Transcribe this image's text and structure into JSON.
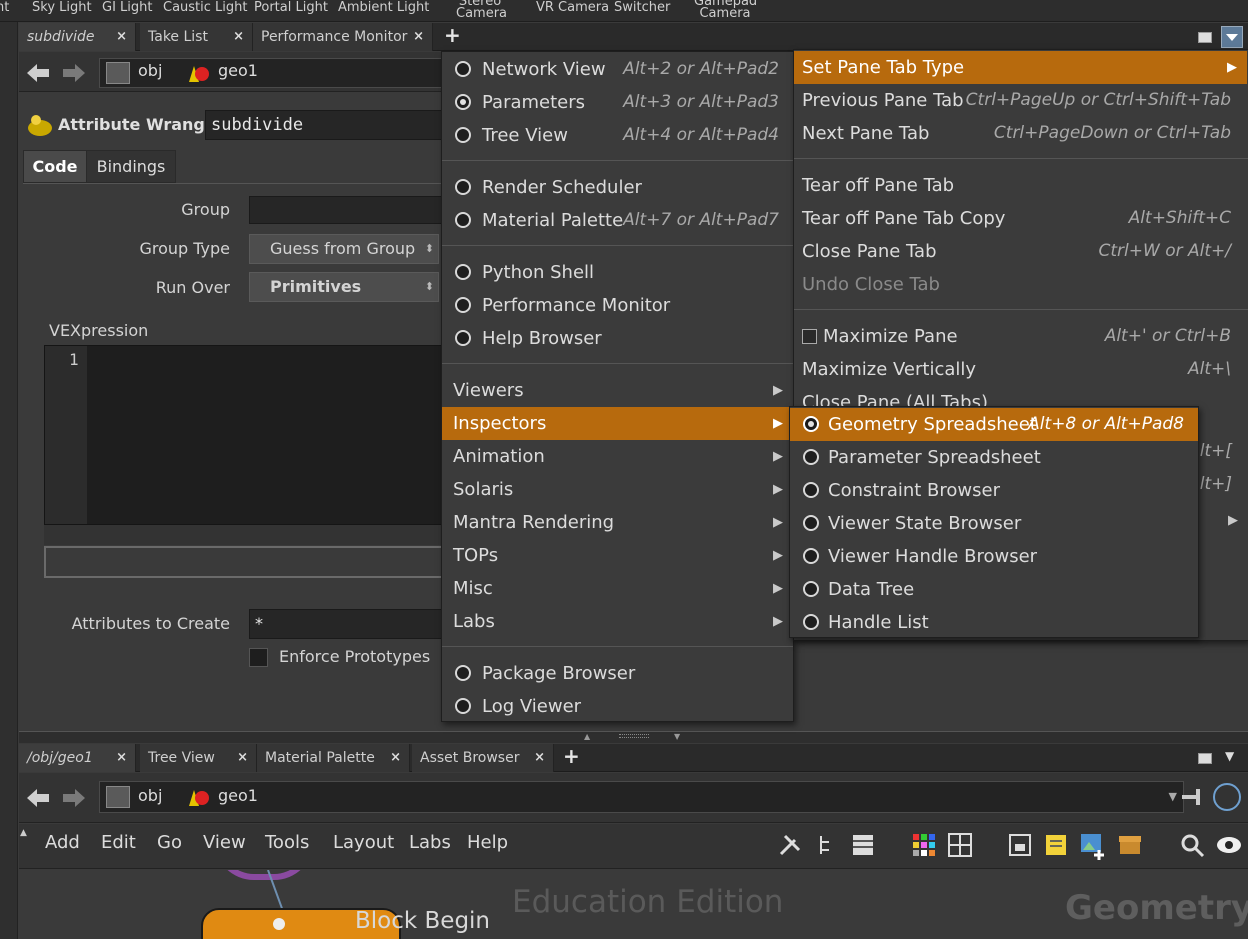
{
  "shelf": {
    "tools": [
      "Sky Light",
      "GI Light",
      "Caustic Light",
      "Portal Light",
      "Ambient Light",
      "Stereo Camera",
      "VR Camera",
      "Switcher",
      "Gamepad Camera"
    ],
    "partial_left": "nt"
  },
  "top_pane": {
    "tabs": [
      {
        "label": "subdivide",
        "close": "×"
      },
      {
        "label": "Take List",
        "close": "×"
      },
      {
        "label": "Performance Monitor",
        "close": "×"
      }
    ],
    "add_tab": "+",
    "path": {
      "network": "obj",
      "node": "geo1"
    },
    "node_type": "Attribute Wrangle",
    "node_name": "subdivide",
    "subtabs": [
      "Code",
      "Bindings"
    ],
    "params": {
      "group_label": "Group",
      "group_type_label": "Group Type",
      "group_type_value": "Guess from Group",
      "run_over_label": "Run Over",
      "run_over_value": "Primitives",
      "vex_label": "VEXpression",
      "line_number": "1",
      "attrs_label": "Attributes to Create",
      "attrs_value": "*",
      "enforce_label": "Enforce Prototypes"
    }
  },
  "pane_type_menu": {
    "items": [
      {
        "label": "Network View",
        "shortcut": "Alt+2 or Alt+Pad2",
        "radio": true,
        "on": false
      },
      {
        "label": "Parameters",
        "shortcut": "Alt+3 or Alt+Pad3",
        "radio": true,
        "on": true
      },
      {
        "label": "Tree View",
        "shortcut": "Alt+4 or Alt+Pad4",
        "radio": true,
        "on": false
      },
      {
        "label": "Render Scheduler",
        "shortcut": "",
        "radio": true,
        "on": false
      },
      {
        "label": "Material Palette",
        "shortcut": "Alt+7 or Alt+Pad7",
        "radio": true,
        "on": false
      },
      {
        "label": "Python Shell",
        "shortcut": "",
        "radio": true,
        "on": false
      },
      {
        "label": "Performance Monitor",
        "shortcut": "",
        "radio": true,
        "on": false
      },
      {
        "label": "Help Browser",
        "shortcut": "",
        "radio": true,
        "on": false
      },
      {
        "label": "Viewers",
        "submenu": true
      },
      {
        "label": "Inspectors",
        "submenu": true,
        "highlight": true
      },
      {
        "label": "Animation",
        "submenu": true
      },
      {
        "label": "Solaris",
        "submenu": true
      },
      {
        "label": "Mantra Rendering",
        "submenu": true
      },
      {
        "label": "TOPs",
        "submenu": true
      },
      {
        "label": "Misc",
        "submenu": true
      },
      {
        "label": "Labs",
        "submenu": true
      },
      {
        "label": "Package Browser",
        "radio": true,
        "on": false
      },
      {
        "label": "Log Viewer",
        "radio": true,
        "on": false
      }
    ]
  },
  "pane_menu": {
    "items": [
      {
        "label": "Set Pane Tab Type",
        "shortcut": "",
        "highlight": true,
        "submenu": true
      },
      {
        "label": "Previous Pane Tab",
        "shortcut": "Ctrl+PageUp or Ctrl+Shift+Tab"
      },
      {
        "label": "Next Pane Tab",
        "shortcut": "Ctrl+PageDown or Ctrl+Tab"
      },
      {
        "label": "Tear off Pane Tab",
        "shortcut": ""
      },
      {
        "label": "Tear off Pane Tab Copy",
        "shortcut": "Alt+Shift+C"
      },
      {
        "label": "Close Pane Tab",
        "shortcut": "Ctrl+W or Alt+/"
      },
      {
        "label": "Undo Close Tab",
        "shortcut": "",
        "disabled": true
      },
      {
        "label": "Maximize Pane",
        "shortcut": "Alt+' or Ctrl+B",
        "checkbox": true
      },
      {
        "label": "Maximize Vertically",
        "shortcut": "Alt+\\"
      },
      {
        "label": "Close Pane (All Tabs)",
        "shortcut": ""
      }
    ],
    "hidden_shortcuts": [
      "Alt+[",
      "Alt+]"
    ]
  },
  "inspectors_menu": {
    "items": [
      {
        "label": "Geometry Spreadsheet",
        "shortcut": "Alt+8 or Alt+Pad8",
        "highlight": true
      },
      {
        "label": "Parameter Spreadsheet"
      },
      {
        "label": "Constraint Browser"
      },
      {
        "label": "Viewer State Browser"
      },
      {
        "label": "Viewer Handle Browser"
      },
      {
        "label": "Data Tree"
      },
      {
        "label": "Handle List"
      }
    ]
  },
  "bottom_pane": {
    "tabs": [
      {
        "label": "/obj/geo1",
        "close": "×"
      },
      {
        "label": "Tree View",
        "close": "×"
      },
      {
        "label": "Material Palette",
        "close": "×"
      },
      {
        "label": "Asset Browser",
        "close": "×"
      }
    ],
    "add_tab": "+",
    "path": {
      "network": "obj",
      "node": "geo1"
    },
    "menubar": [
      "Add",
      "Edit",
      "Go",
      "View",
      "Tools",
      "Layout",
      "Labs",
      "Help"
    ],
    "watermark_edition": "Education Edition",
    "watermark_context": "Geometry",
    "node_label": "Block Begin"
  },
  "colors": {
    "highlight": "#b76a0d",
    "panel": "#3a3a3a",
    "menu": "#3b3b3b"
  }
}
